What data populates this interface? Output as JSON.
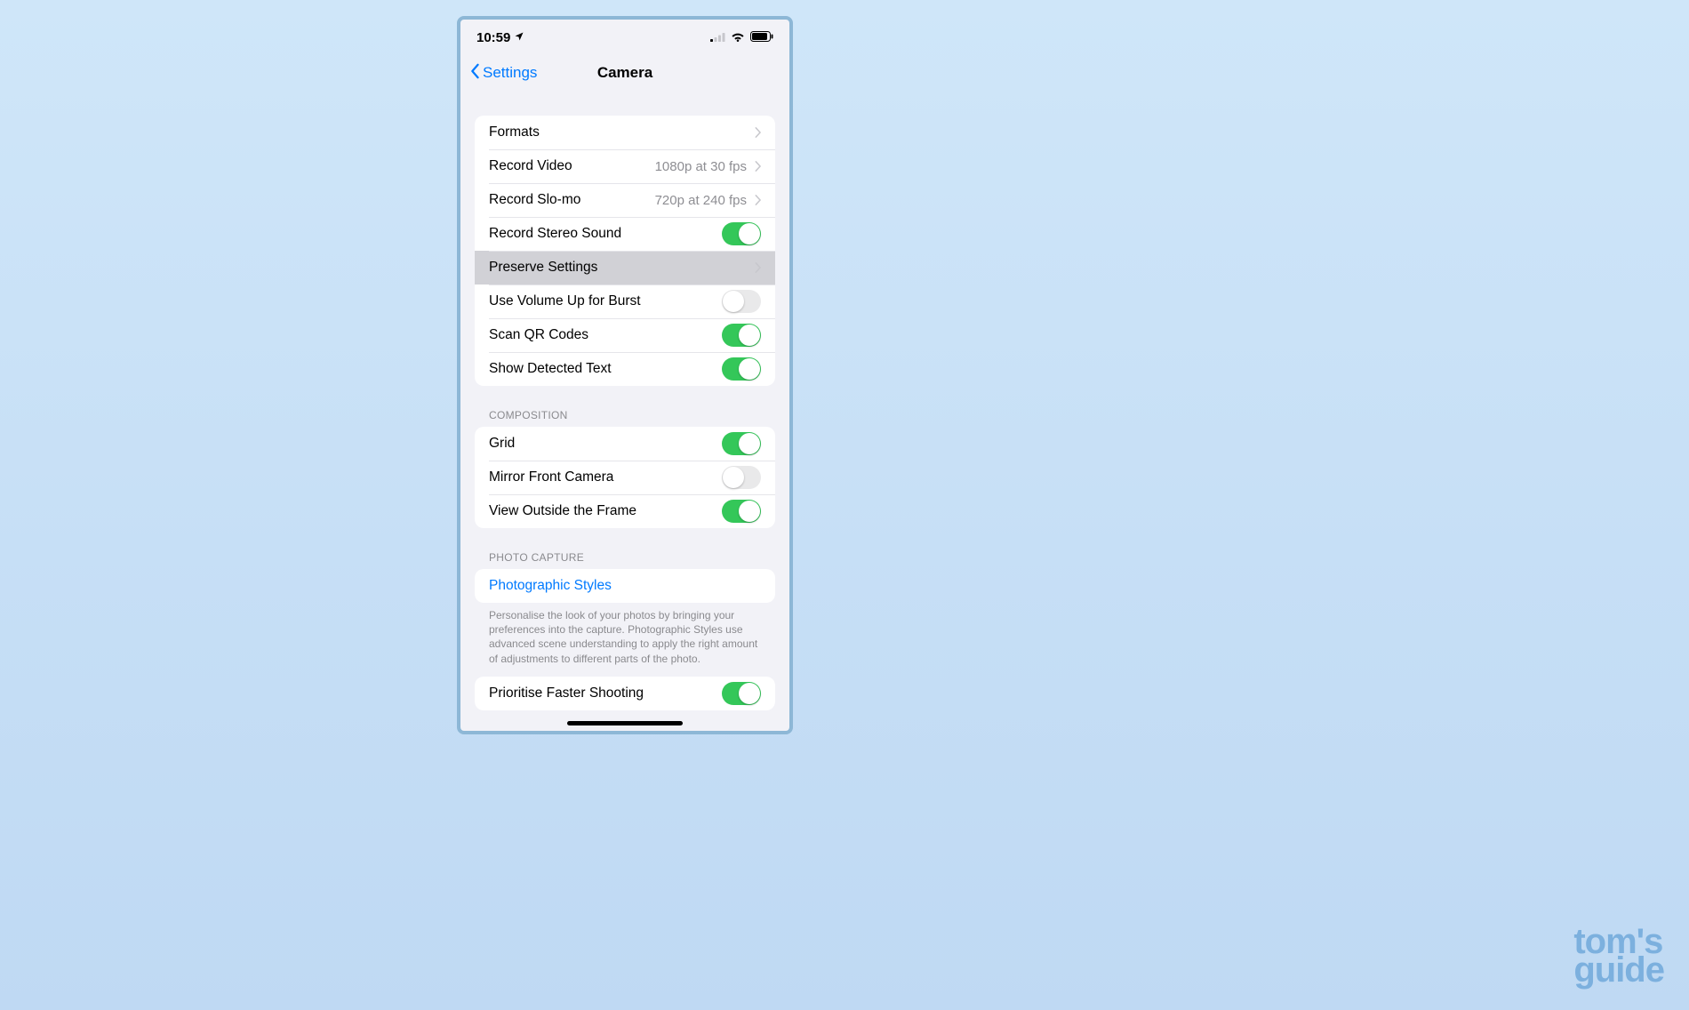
{
  "status_bar": {
    "time": "10:59",
    "location_icon": "location",
    "signal_icon": "cell-signal",
    "wifi_icon": "wifi",
    "battery_icon": "battery"
  },
  "nav": {
    "back_label": "Settings",
    "title": "Camera"
  },
  "sections": [
    {
      "header": "",
      "rows": [
        {
          "label": "Formats",
          "type": "chevron",
          "value": ""
        },
        {
          "label": "Record Video",
          "type": "chevron",
          "value": "1080p at 30 fps"
        },
        {
          "label": "Record Slo-mo",
          "type": "chevron",
          "value": "720p at 240 fps"
        },
        {
          "label": "Record Stereo Sound",
          "type": "toggle",
          "on": true
        },
        {
          "label": "Preserve Settings",
          "type": "chevron",
          "value": "",
          "highlight": true
        },
        {
          "label": "Use Volume Up for Burst",
          "type": "toggle",
          "on": false
        },
        {
          "label": "Scan QR Codes",
          "type": "toggle",
          "on": true
        },
        {
          "label": "Show Detected Text",
          "type": "toggle",
          "on": true
        }
      ]
    },
    {
      "header": "COMPOSITION",
      "rows": [
        {
          "label": "Grid",
          "type": "toggle",
          "on": true
        },
        {
          "label": "Mirror Front Camera",
          "type": "toggle",
          "on": false
        },
        {
          "label": "View Outside the Frame",
          "type": "toggle",
          "on": true
        }
      ]
    },
    {
      "header": "PHOTO CAPTURE",
      "rows": [
        {
          "label": "Photographic Styles",
          "type": "link"
        }
      ],
      "footer": "Personalise the look of your photos by bringing your preferences into the capture. Photographic Styles use advanced scene understanding to apply the right amount of adjustments to different parts of the photo."
    },
    {
      "header": "",
      "rows": [
        {
          "label": "Prioritise Faster Shooting",
          "type": "toggle",
          "on": true
        }
      ]
    }
  ],
  "watermark": {
    "line1": "tom's",
    "line2": "guide"
  }
}
